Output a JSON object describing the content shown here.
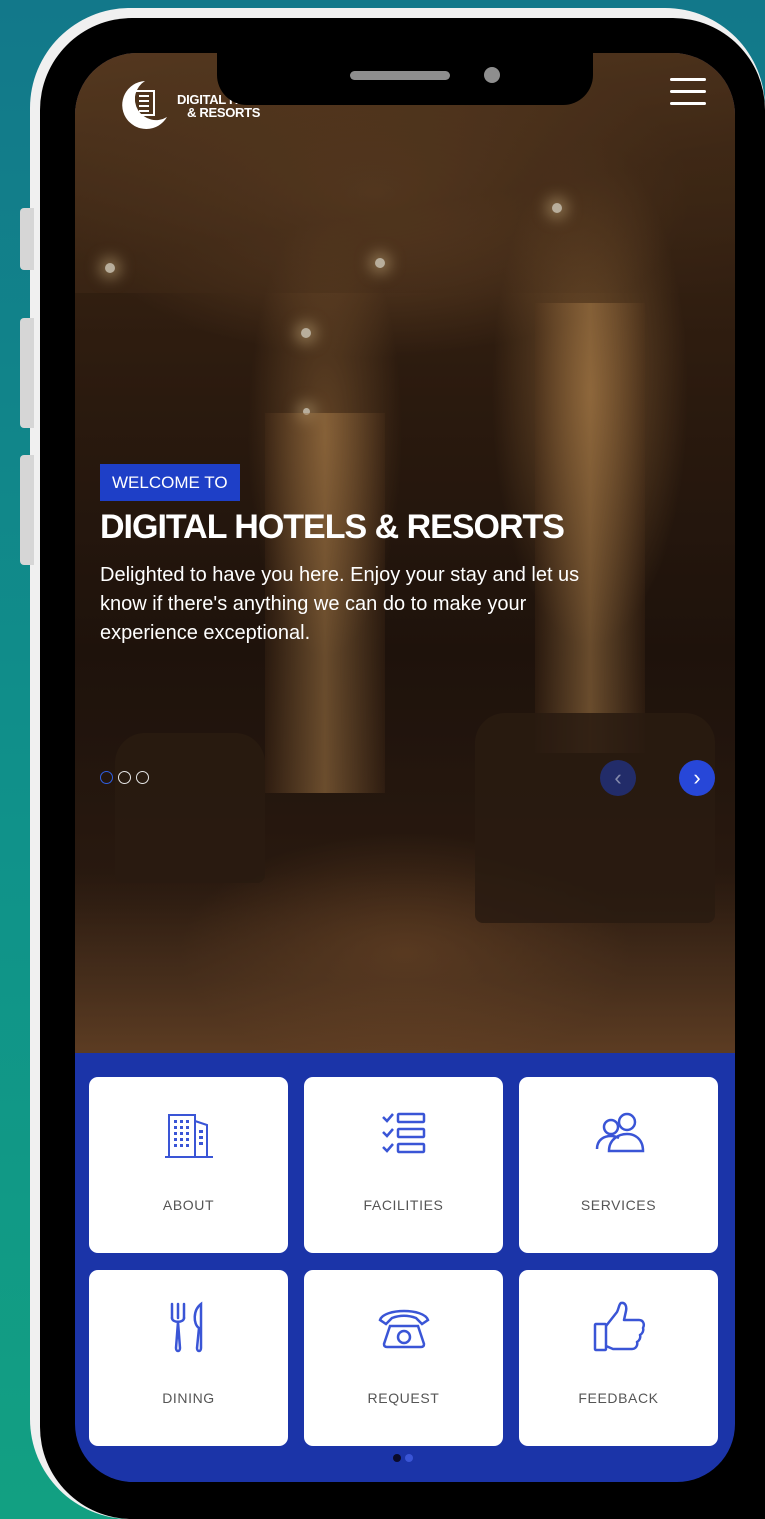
{
  "brand": {
    "logo_line1": "DIGITAL HOTELS",
    "logo_line2": "& RESORTS"
  },
  "hero": {
    "welcome_tag": "WELCOME TO",
    "title": "DIGITAL HOTELS & RESORTS",
    "text": "Delighted to have you here. Enjoy your stay and let us know if there's anything we can do to make your experience exceptional.",
    "slide_count": 3,
    "active_slide": 1,
    "prev_arrow": "‹",
    "next_arrow": "›"
  },
  "tiles": [
    {
      "label": "ABOUT",
      "icon": "building-icon"
    },
    {
      "label": "FACILITIES",
      "icon": "checklist-icon"
    },
    {
      "label": "SERVICES",
      "icon": "users-icon"
    },
    {
      "label": "DINING",
      "icon": "fork-knife-icon"
    },
    {
      "label": "REQUEST",
      "icon": "telephone-icon"
    },
    {
      "label": "FEEDBACK",
      "icon": "thumbs-up-icon"
    }
  ],
  "pager": {
    "pages": 2,
    "active_page": 1
  },
  "colors": {
    "primary_blue": "#1b34a8",
    "accent_blue": "#1e3fc7",
    "icon_blue": "#3a55d6",
    "background_teal": "#12788a"
  }
}
